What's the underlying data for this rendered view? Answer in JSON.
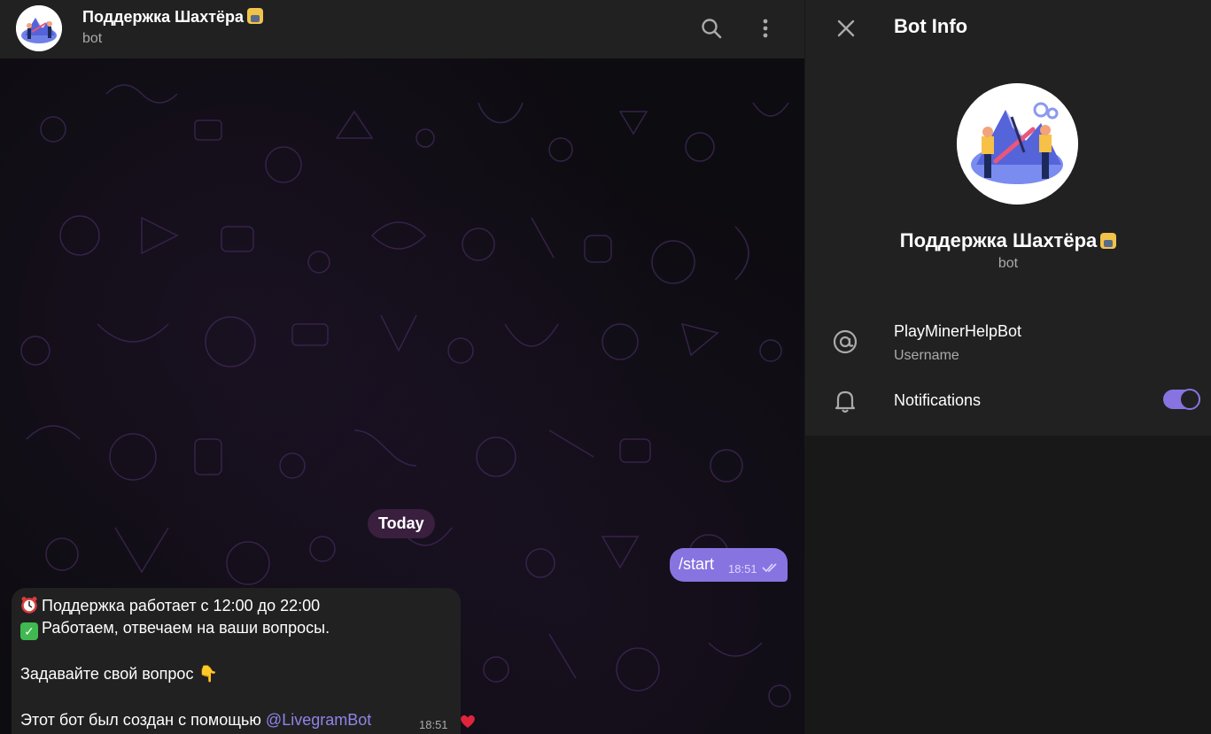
{
  "chat": {
    "title": "Поддержка Шахтёра",
    "subtitle": "bot",
    "date_separator": "Today",
    "outgoing": {
      "text": "/start",
      "time": "18:51",
      "status": "read"
    },
    "incoming": {
      "line1": "Поддержка работает с 12:00 до 22:00",
      "line2": "Работаем, отвечаем на ваши вопросы.",
      "line3": "Задавайте свой вопрос 👇",
      "line4_prefix": "Этот бот был создан с помощью ",
      "line4_link": "@LivegramBot",
      "time": "18:51",
      "reaction": "heart"
    }
  },
  "info_panel": {
    "title": "Bot Info",
    "name": "Поддержка Шахтёра",
    "subtitle": "bot",
    "username": "PlayMinerHelpBot",
    "username_label": "Username",
    "notifications_label": "Notifications",
    "notifications_on": true
  },
  "icons": [
    "search-icon",
    "more-vertical-icon",
    "close-icon",
    "at-icon",
    "bell-icon",
    "alarm-clock-icon",
    "check-mark-icon",
    "heart-icon",
    "double-check-icon"
  ],
  "colors": {
    "accent": "#8774e1",
    "panel": "#212121",
    "background": "#181818",
    "date_pill": "#3a1f3f",
    "link": "#8f84e8"
  }
}
